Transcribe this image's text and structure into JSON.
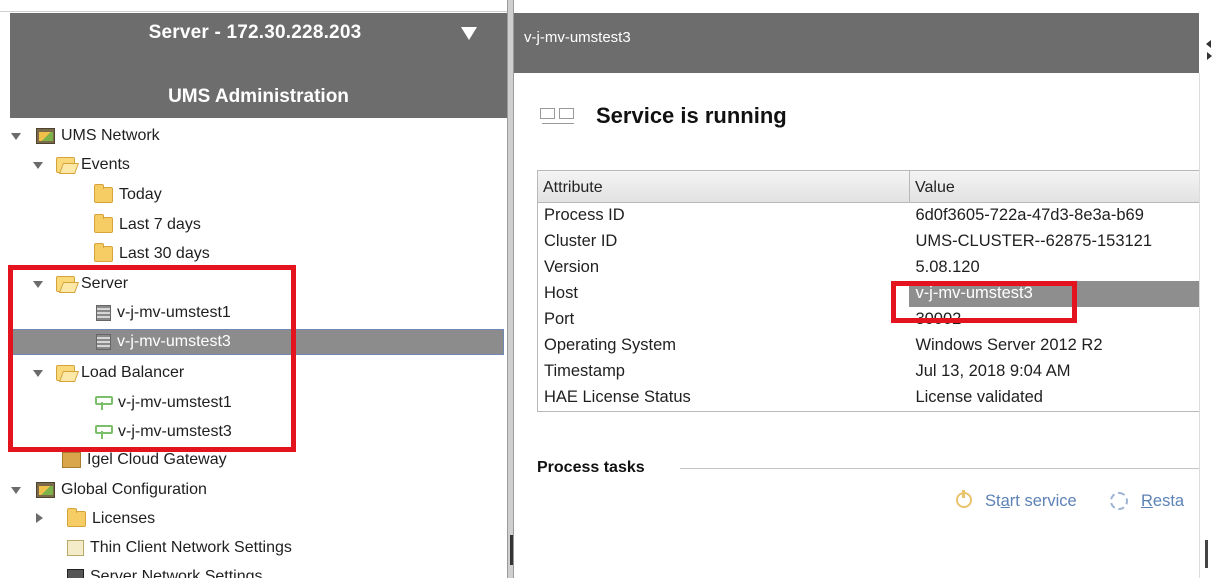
{
  "server_header": {
    "title": "Server - 172.30.228.203",
    "subtitle": "UMS Administration"
  },
  "tree": {
    "ums_network": "UMS Network",
    "events": "Events",
    "today": "Today",
    "last_7_days": "Last 7 days",
    "last_30_days": "Last 30 days",
    "server": "Server",
    "server_1": "v-j-mv-umstest1",
    "server_3": "v-j-mv-umstest3",
    "load_balancer": "Load Balancer",
    "lb_1": "v-j-mv-umstest1",
    "lb_3": "v-j-mv-umstest3",
    "igel_cloud_gateway": "Igel Cloud Gateway",
    "global_configuration": "Global Configuration",
    "licenses": "Licenses",
    "thin_client_network_settings": "Thin Client Network Settings",
    "server_network_settings": "Server Network Settings"
  },
  "detail": {
    "header_title": "v-j-mv-umstest3",
    "status_title": "Service is running",
    "table": {
      "col_attribute": "Attribute",
      "col_value": "Value",
      "rows": [
        {
          "attribute": "Process ID",
          "value": "6d0f3605-722a-47d3-8e3a-b69"
        },
        {
          "attribute": "Cluster ID",
          "value": "UMS-CLUSTER--62875-153121"
        },
        {
          "attribute": "Version",
          "value": "5.08.120"
        },
        {
          "attribute": "Host",
          "value": "v-j-mv-umstest3"
        },
        {
          "attribute": "Port",
          "value": "30002"
        },
        {
          "attribute": "Operating System",
          "value": "Windows Server 2012 R2"
        },
        {
          "attribute": "Timestamp",
          "value": "Jul 13, 2018 9:04 AM"
        },
        {
          "attribute": "HAE License Status",
          "value": "License validated"
        }
      ]
    },
    "process_tasks_label": "Process tasks",
    "start_service_pre": "St",
    "start_service_u": "a",
    "start_service_post": "rt service",
    "restart_u": "R",
    "restart_rest": "esta"
  },
  "colors": {
    "highlight_red": "#e3141d",
    "header_gray": "#6d6d6d",
    "link_blue": "#5d82b6",
    "selection_gray": "#8c8c8c"
  }
}
